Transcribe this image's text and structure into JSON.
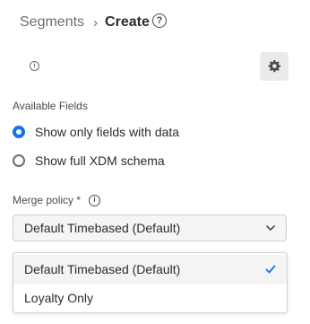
{
  "header": {
    "breadcrumb_parent": "Segments",
    "breadcrumb_separator": "›",
    "breadcrumb_current": "Create",
    "help_icon": "help-circle-icon",
    "help_glyph": "?"
  },
  "toolbar": {
    "info_glyph": "i",
    "settings_icon": "gear-icon"
  },
  "available_fields": {
    "label": "Available Fields",
    "options": [
      {
        "label": "Show only fields with data",
        "selected": true
      },
      {
        "label": "Show full XDM schema",
        "selected": false
      }
    ]
  },
  "merge_policy": {
    "label": "Merge policy *",
    "info_glyph": "i",
    "selected_value": "Default Timebased (Default)",
    "options": [
      {
        "label": "Default Timebased (Default)",
        "selected": true
      },
      {
        "label": "Loyalty Only",
        "selected": false
      }
    ]
  },
  "colors": {
    "accent": "#1473e6",
    "text": "#2c2c2c",
    "muted": "#6e6e6e"
  }
}
